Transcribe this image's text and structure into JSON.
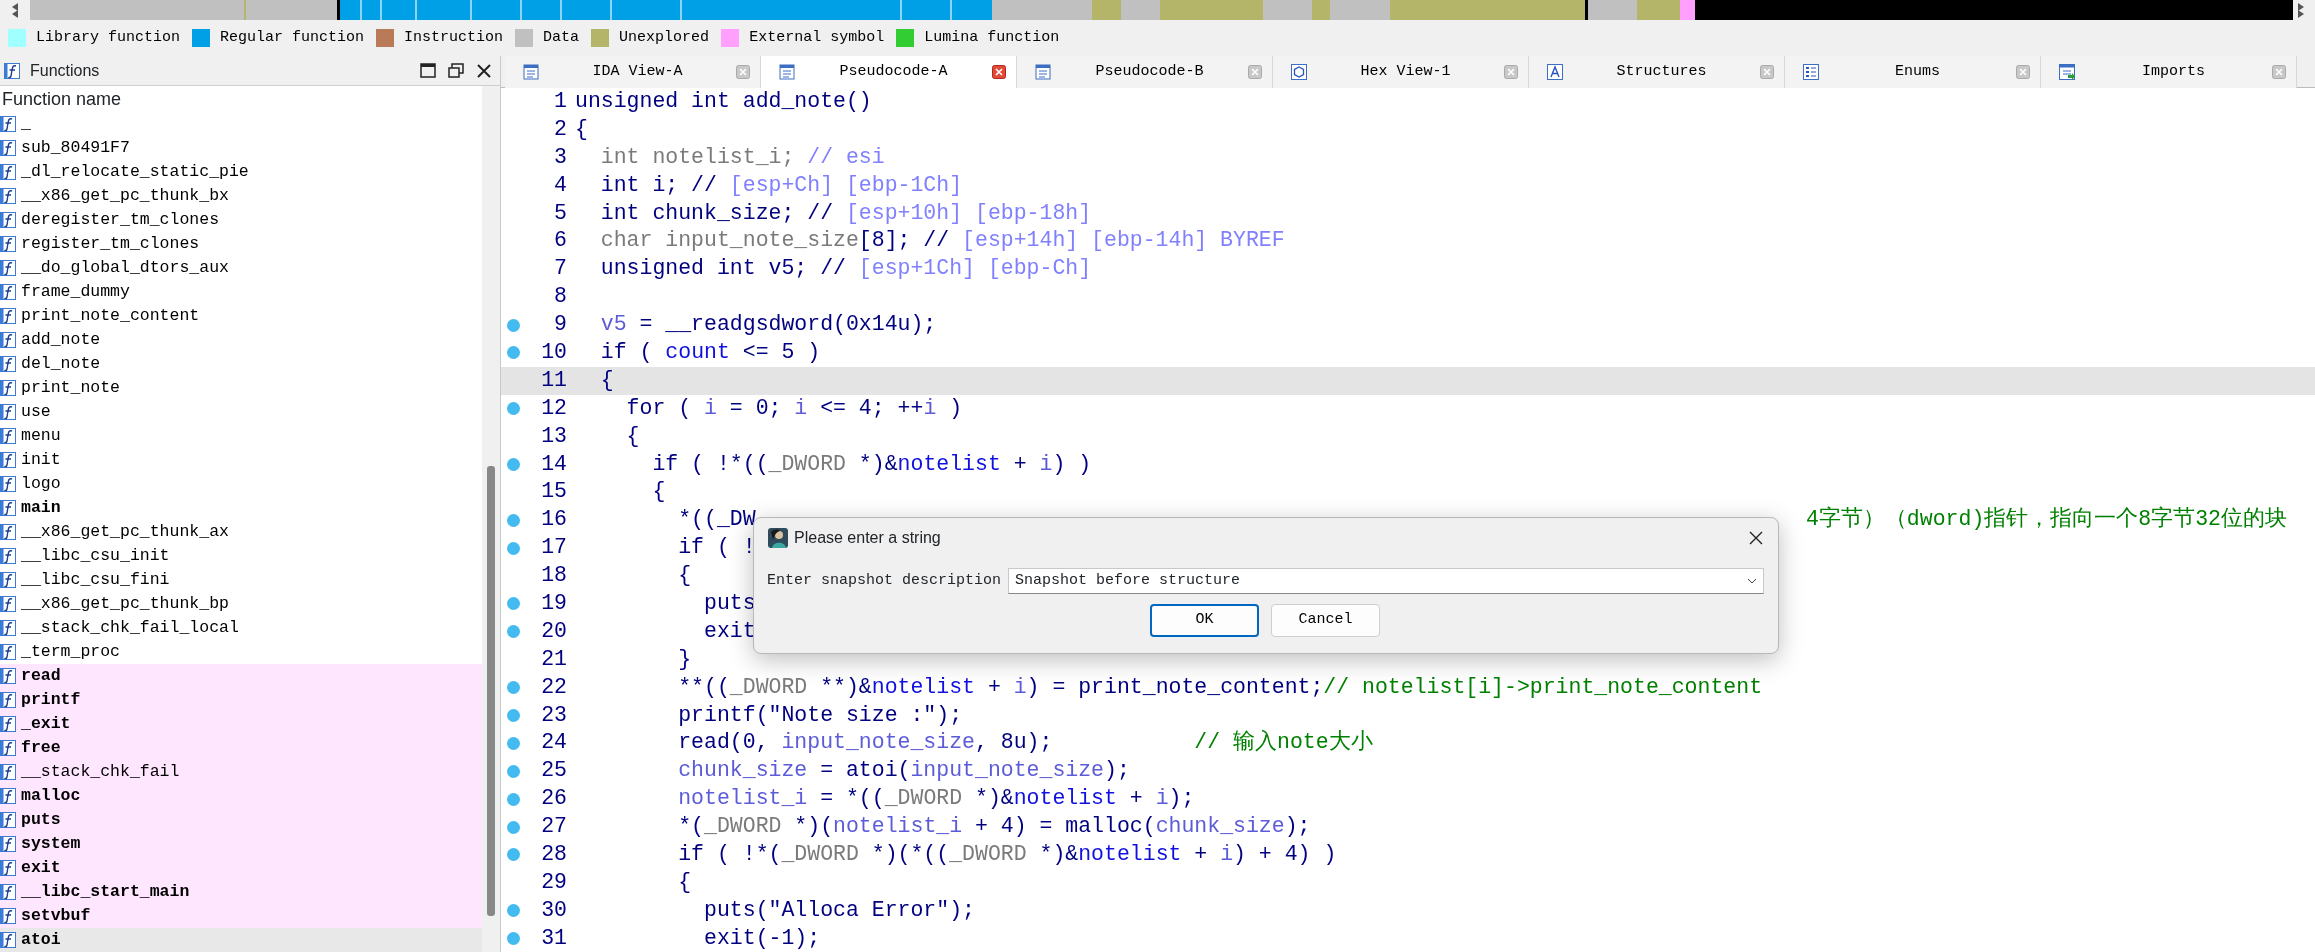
{
  "legend": [
    {
      "label": "Library function",
      "color": "#a0ffff"
    },
    {
      "label": "Regular function",
      "color": "#00a0e6"
    },
    {
      "label": "Instruction",
      "color": "#b97a57"
    },
    {
      "label": "Data",
      "color": "#c0c0c0"
    },
    {
      "label": "Unexplored",
      "color": "#b5b56a"
    },
    {
      "label": "External symbol",
      "color": "#ffa0ff"
    },
    {
      "label": "Lumina function",
      "color": "#32cd32"
    }
  ],
  "functions": {
    "title": "Functions",
    "column": "Function name",
    "items": [
      {
        "name": "_",
        "external": false,
        "selected": false
      },
      {
        "name": "sub_80491F7",
        "bold": false,
        "external": false,
        "selected": false
      },
      {
        "name": "_dl_relocate_static_pie",
        "bold": false,
        "external": false,
        "selected": false
      },
      {
        "name": "__x86_get_pc_thunk_bx",
        "bold": false,
        "external": false,
        "selected": false
      },
      {
        "name": "deregister_tm_clones",
        "bold": false,
        "external": false,
        "selected": false
      },
      {
        "name": "register_tm_clones",
        "bold": false,
        "external": false,
        "selected": false
      },
      {
        "name": "__do_global_dtors_aux",
        "bold": false,
        "external": false,
        "selected": false
      },
      {
        "name": "frame_dummy",
        "bold": false,
        "external": false,
        "selected": false
      },
      {
        "name": "print_note_content",
        "bold": false,
        "external": false,
        "selected": false
      },
      {
        "name": "add_note",
        "bold": false,
        "external": false,
        "selected": false
      },
      {
        "name": "del_note",
        "bold": false,
        "external": false,
        "selected": false
      },
      {
        "name": "print_note",
        "bold": false,
        "external": false,
        "selected": false
      },
      {
        "name": "use",
        "bold": false,
        "external": false,
        "selected": false
      },
      {
        "name": "menu",
        "bold": false,
        "external": false,
        "selected": false
      },
      {
        "name": "init",
        "bold": false,
        "external": false,
        "selected": false
      },
      {
        "name": "logo",
        "bold": false,
        "external": false,
        "selected": false
      },
      {
        "name": "main",
        "bold": true,
        "external": false,
        "selected": false
      },
      {
        "name": "__x86_get_pc_thunk_ax",
        "bold": false,
        "external": false,
        "selected": false
      },
      {
        "name": "__libc_csu_init",
        "bold": false,
        "external": false,
        "selected": false
      },
      {
        "name": "__libc_csu_fini",
        "bold": false,
        "external": false,
        "selected": false
      },
      {
        "name": "__x86_get_pc_thunk_bp",
        "bold": false,
        "external": false,
        "selected": false
      },
      {
        "name": "__stack_chk_fail_local",
        "bold": false,
        "external": false,
        "selected": false
      },
      {
        "name": "_term_proc",
        "bold": false,
        "external": false,
        "selected": false
      },
      {
        "name": "read",
        "bold": true,
        "external": true,
        "selected": false
      },
      {
        "name": "printf",
        "bold": true,
        "external": true,
        "selected": false
      },
      {
        "name": "_exit",
        "bold": true,
        "external": true,
        "selected": false
      },
      {
        "name": "free",
        "bold": true,
        "external": true,
        "selected": false
      },
      {
        "name": "__stack_chk_fail",
        "bold": false,
        "external": true,
        "selected": false
      },
      {
        "name": "malloc",
        "bold": true,
        "external": true,
        "selected": false
      },
      {
        "name": "puts",
        "bold": true,
        "external": true,
        "selected": false
      },
      {
        "name": "system",
        "bold": true,
        "external": true,
        "selected": false
      },
      {
        "name": "exit",
        "bold": true,
        "external": true,
        "selected": false
      },
      {
        "name": "__libc_start_main",
        "bold": true,
        "external": true,
        "selected": false
      },
      {
        "name": "setvbuf",
        "bold": true,
        "external": true,
        "selected": false
      },
      {
        "name": "atoi",
        "bold": true,
        "external": false,
        "selected": true
      }
    ]
  },
  "tabs": [
    {
      "label": "IDA View-A",
      "kind": "listing",
      "selected": false
    },
    {
      "label": "Pseudocode-A",
      "kind": "listing",
      "selected": true
    },
    {
      "label": "Pseudocode-B",
      "kind": "listing",
      "selected": false
    },
    {
      "label": "Hex View-1",
      "kind": "hex",
      "selected": false
    },
    {
      "label": "Structures",
      "kind": "struct",
      "selected": false
    },
    {
      "label": "Enums",
      "kind": "enum",
      "selected": false
    },
    {
      "label": "Imports",
      "kind": "import",
      "selected": false
    }
  ],
  "code": {
    "lines": [
      {
        "number": "1",
        "breakpoint": false,
        "highlighted": false,
        "tokens": [
          {
            "kind": "plain",
            "text": "unsigned int add_note()"
          }
        ]
      },
      {
        "number": "2",
        "breakpoint": false,
        "highlighted": false,
        "tokens": [
          {
            "kind": "plain",
            "text": "{"
          }
        ]
      },
      {
        "number": "3",
        "breakpoint": false,
        "highlighted": false,
        "tokens": [
          {
            "kind": "dim",
            "text": "  int notelist_i; "
          },
          {
            "kind": "hint",
            "text": "// esi"
          }
        ]
      },
      {
        "number": "4",
        "breakpoint": false,
        "highlighted": false,
        "tokens": [
          {
            "kind": "plain",
            "text": "  int i; // "
          },
          {
            "kind": "hint",
            "text": "[esp+Ch] [ebp-1Ch]"
          }
        ]
      },
      {
        "number": "5",
        "breakpoint": false,
        "highlighted": false,
        "tokens": [
          {
            "kind": "plain",
            "text": "  int chunk_size; // "
          },
          {
            "kind": "hint",
            "text": "[esp+10h] [ebp-18h]"
          }
        ]
      },
      {
        "number": "6",
        "breakpoint": false,
        "highlighted": false,
        "tokens": [
          {
            "kind": "dim",
            "text": "  char input_note_size"
          },
          {
            "kind": "plain",
            "text": "[8]; // "
          },
          {
            "kind": "hint",
            "text": "[esp+14h] [ebp-14h] BYREF"
          }
        ]
      },
      {
        "number": "7",
        "breakpoint": false,
        "highlighted": false,
        "tokens": [
          {
            "kind": "plain",
            "text": "  unsigned int v5; // "
          },
          {
            "kind": "hint",
            "text": "[esp+1Ch] [ebp-Ch]"
          }
        ]
      },
      {
        "number": "8",
        "breakpoint": false,
        "highlighted": false
      },
      {
        "number": "9",
        "breakpoint": true,
        "highlighted": false,
        "tokens": [
          {
            "kind": "var",
            "text": "  v5"
          },
          {
            "kind": "plain",
            "text": " = __readgsdword(0x14u);"
          }
        ]
      },
      {
        "number": "10",
        "breakpoint": true,
        "highlighted": false,
        "tokens": [
          {
            "kind": "plain",
            "text": "  if ( "
          },
          {
            "kind": "global",
            "text": "count"
          },
          {
            "kind": "plain",
            "text": " <= 5 )"
          }
        ]
      },
      {
        "number": "11",
        "breakpoint": false,
        "highlighted": true,
        "tokens": [
          {
            "kind": "plain",
            "text": "  {"
          }
        ]
      },
      {
        "number": "12",
        "breakpoint": true,
        "highlighted": false,
        "tokens": [
          {
            "kind": "plain",
            "text": "    for ( "
          },
          {
            "kind": "var",
            "text": "i"
          },
          {
            "kind": "plain",
            "text": " = 0; "
          },
          {
            "kind": "var",
            "text": "i"
          },
          {
            "kind": "plain",
            "text": " <= 4; ++"
          },
          {
            "kind": "var",
            "text": "i"
          },
          {
            "kind": "plain",
            "text": " )"
          }
        ]
      },
      {
        "number": "13",
        "breakpoint": false,
        "highlighted": false,
        "tokens": [
          {
            "kind": "plain",
            "text": "    {"
          }
        ]
      },
      {
        "number": "14",
        "breakpoint": true,
        "highlighted": false,
        "tokens": [
          {
            "kind": "plain",
            "text": "      if ( !*(("
          },
          {
            "kind": "dim",
            "text": "_DWORD"
          },
          {
            "kind": "plain",
            "text": " *)&"
          },
          {
            "kind": "global",
            "text": "notelist"
          },
          {
            "kind": "plain",
            "text": " + "
          },
          {
            "kind": "var",
            "text": "i"
          },
          {
            "kind": "plain",
            "text": ") )"
          }
        ]
      },
      {
        "number": "15",
        "breakpoint": false,
        "highlighted": false,
        "tokens": [
          {
            "kind": "plain",
            "text": "      {"
          }
        ]
      },
      {
        "number": "16",
        "breakpoint": true,
        "highlighted": false,
        "tokens": [
          {
            "kind": "plain",
            "text": "        *((_DW"
          },
          {
            "kind": "tail-comment",
            "text": "4字节）（dword)指针，指向一个8字节32位的块"
          }
        ]
      },
      {
        "number": "17",
        "breakpoint": true,
        "highlighted": false,
        "tokens": [
          {
            "kind": "plain",
            "text": "        if ( !"
          }
        ]
      },
      {
        "number": "18",
        "breakpoint": false,
        "highlighted": false,
        "tokens": [
          {
            "kind": "plain",
            "text": "        {"
          }
        ]
      },
      {
        "number": "19",
        "breakpoint": true,
        "highlighted": false,
        "tokens": [
          {
            "kind": "plain",
            "text": "          puts"
          }
        ]
      },
      {
        "number": "20",
        "breakpoint": true,
        "highlighted": false,
        "tokens": [
          {
            "kind": "plain",
            "text": "          exit"
          }
        ]
      },
      {
        "number": "21",
        "breakpoint": false,
        "highlighted": false,
        "tokens": [
          {
            "kind": "plain",
            "text": "        }"
          }
        ]
      },
      {
        "number": "22",
        "breakpoint": true,
        "highlighted": false,
        "tokens": [
          {
            "kind": "plain",
            "text": "        **(("
          },
          {
            "kind": "dim",
            "text": "_DWORD"
          },
          {
            "kind": "plain",
            "text": " **)&"
          },
          {
            "kind": "global",
            "text": "notelist"
          },
          {
            "kind": "plain",
            "text": " + "
          },
          {
            "kind": "var",
            "text": "i"
          },
          {
            "kind": "plain",
            "text": ") = print_note_content;"
          },
          {
            "kind": "comment",
            "text": "// notelist[i]->print_note_content"
          }
        ]
      },
      {
        "number": "23",
        "breakpoint": true,
        "highlighted": false,
        "tokens": [
          {
            "kind": "plain",
            "text": "        printf(\"Note size :\");"
          }
        ]
      },
      {
        "number": "24",
        "breakpoint": true,
        "highlighted": false,
        "tokens": [
          {
            "kind": "plain",
            "text": "        read(0, "
          },
          {
            "kind": "var",
            "text": "input_note_size"
          },
          {
            "kind": "plain",
            "text": ", 8u);           "
          },
          {
            "kind": "comment",
            "text": "// 输入note大小"
          }
        ]
      },
      {
        "number": "25",
        "breakpoint": true,
        "highlighted": false,
        "tokens": [
          {
            "kind": "var",
            "text": "        chunk_size"
          },
          {
            "kind": "plain",
            "text": " = atoi("
          },
          {
            "kind": "var",
            "text": "input_note_size"
          },
          {
            "kind": "plain",
            "text": ");"
          }
        ]
      },
      {
        "number": "26",
        "breakpoint": true,
        "highlighted": false,
        "tokens": [
          {
            "kind": "var",
            "text": "        notelist_i"
          },
          {
            "kind": "plain",
            "text": " = *(("
          },
          {
            "kind": "dim",
            "text": "_DWORD"
          },
          {
            "kind": "plain",
            "text": " *)&"
          },
          {
            "kind": "global",
            "text": "notelist"
          },
          {
            "kind": "plain",
            "text": " + "
          },
          {
            "kind": "var",
            "text": "i"
          },
          {
            "kind": "plain",
            "text": ");"
          }
        ]
      },
      {
        "number": "27",
        "breakpoint": true,
        "highlighted": false,
        "tokens": [
          {
            "kind": "plain",
            "text": "        *("
          },
          {
            "kind": "dim",
            "text": "_DWORD"
          },
          {
            "kind": "plain",
            "text": " *)("
          },
          {
            "kind": "var",
            "text": "notelist_i"
          },
          {
            "kind": "plain",
            "text": " + 4) = malloc("
          },
          {
            "kind": "var",
            "text": "chunk_size"
          },
          {
            "kind": "plain",
            "text": ");"
          }
        ]
      },
      {
        "number": "28",
        "breakpoint": true,
        "highlighted": false,
        "tokens": [
          {
            "kind": "plain",
            "text": "        if ( !*("
          },
          {
            "kind": "dim",
            "text": "_DWORD"
          },
          {
            "kind": "plain",
            "text": " *)(*(("
          },
          {
            "kind": "dim",
            "text": "_DWORD"
          },
          {
            "kind": "plain",
            "text": " *)&"
          },
          {
            "kind": "global",
            "text": "notelist"
          },
          {
            "kind": "plain",
            "text": " + "
          },
          {
            "kind": "var",
            "text": "i"
          },
          {
            "kind": "plain",
            "text": ") + 4) )"
          }
        ]
      },
      {
        "number": "29",
        "breakpoint": false,
        "highlighted": false,
        "tokens": [
          {
            "kind": "plain",
            "text": "        {"
          }
        ]
      },
      {
        "number": "30",
        "breakpoint": true,
        "highlighted": false,
        "tokens": [
          {
            "kind": "plain",
            "text": "          puts(\"Alloca Error\");"
          }
        ]
      },
      {
        "number": "31",
        "breakpoint": true,
        "highlighted": false,
        "tokens": [
          {
            "kind": "plain",
            "text": "          exit(-1);"
          }
        ]
      }
    ]
  },
  "dialog": {
    "title": "Please enter a string",
    "label": "Enter snapshot description",
    "value": "Snapshot before structure",
    "buttons": [
      {
        "label": "OK",
        "default": true
      },
      {
        "label": "Cancel",
        "default": false
      }
    ]
  }
}
